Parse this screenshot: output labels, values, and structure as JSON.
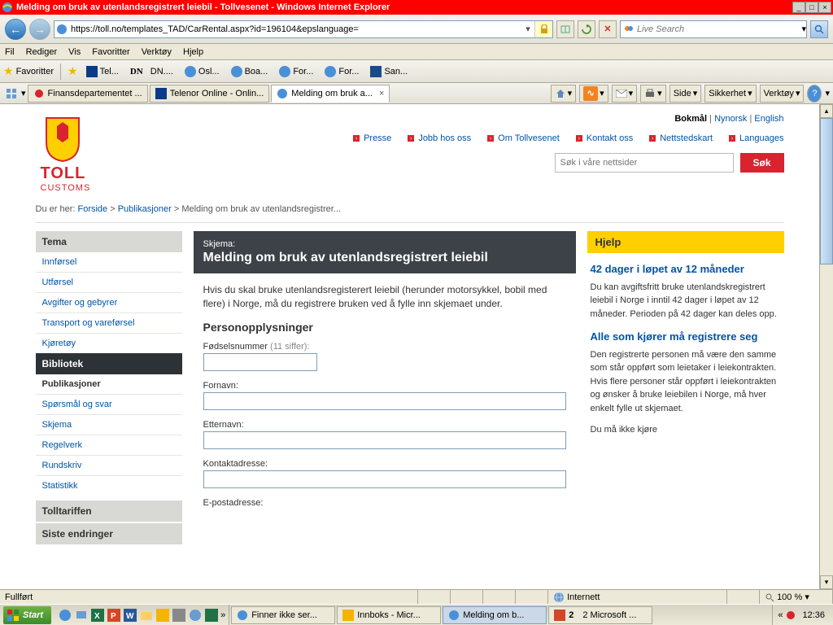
{
  "window": {
    "title": "Melding om bruk av utenlandsregistrert leiebil - Tollvesenet - Windows Internet Explorer",
    "address_url": "https://toll.no/templates_TAD/CarRental.aspx?id=196104&epslanguage=",
    "search_placeholder": "Live Search"
  },
  "menu": {
    "file": "Fil",
    "edit": "Rediger",
    "view": "Vis",
    "favorites": "Favoritter",
    "tools": "Verktøy",
    "help": "Hjelp"
  },
  "bookmarks_label": "Favoritter",
  "bookmarks": [
    {
      "label": "Tel..."
    },
    {
      "label": "DN...."
    },
    {
      "label": "Osl..."
    },
    {
      "label": "Boa..."
    },
    {
      "label": "For..."
    },
    {
      "label": "For..."
    },
    {
      "label": "San..."
    }
  ],
  "tabs": [
    {
      "label": "Finansdepartementet ..."
    },
    {
      "label": "Telenor Online - Onlin..."
    },
    {
      "label": "Melding om bruk a...",
      "active": true
    }
  ],
  "cmdbar": {
    "side": "Side",
    "sikkerhet": "Sikkerhet",
    "verktoy": "Verktøy"
  },
  "page": {
    "lang": {
      "bokmal": "Bokmål",
      "nynorsk": "Nynorsk",
      "english": "English"
    },
    "logo": {
      "line1": "TOLL",
      "line2": "CUSTOMS"
    },
    "topnav": [
      {
        "label": "Presse"
      },
      {
        "label": "Jobb hos oss"
      },
      {
        "label": "Om Tollvesenet"
      },
      {
        "label": "Kontakt oss"
      },
      {
        "label": "Nettstedskart"
      },
      {
        "label": "Languages"
      }
    ],
    "search_placeholder": "Søk i våre nettsider",
    "search_button": "Søk",
    "breadcrumb": {
      "prefix": "Du er her:",
      "p1": "Forside",
      "p2": "Publikasjoner",
      "p3": "Melding om bruk av utenlandsregistrer..."
    },
    "left": {
      "tema_title": "Tema",
      "tema_items": [
        "Innførsel",
        "Utførsel",
        "Avgifter og gebyrer",
        "Transport og vareførsel",
        "Kjøretøy"
      ],
      "bibliotek_title": "Bibliotek",
      "bibliotek_items": [
        "Publikasjoner",
        "Spørsmål og svar",
        "Skjema",
        "Regelverk",
        "Rundskriv",
        "Statistikk"
      ],
      "tolltariffen": "Tolltariffen",
      "siste": "Siste endringer"
    },
    "form": {
      "skjema": "Skjema:",
      "title": "Melding om bruk av utenlandsregistrert leiebil",
      "intro": "Hvis du skal bruke utenlandsregisterert leiebil (herunder motorsykkel, bobil med flere) i Norge, må du registrere bruken ved å fylle inn skjemaet under.",
      "section": "Personopplysninger",
      "f_fodsel": "Fødselsnummer",
      "f_fodsel_hint": "(11 siffer):",
      "f_fornavn": "Fornavn:",
      "f_etternavn": "Etternavn:",
      "f_kontakt": "Kontaktadresse:",
      "f_epost": "E-postadresse:"
    },
    "help": {
      "title": "Hjelp",
      "h1": "42 dager i løpet av 12 måneder",
      "p1": "Du kan avgiftsfritt bruke utenlandskregistrert leiebil i Norge i inntil 42 dager i løpet av 12 måneder. Perioden på 42 dager kan deles opp.",
      "h2": "Alle som kjører må registrere seg",
      "p2": "Den registrerte personen må være den samme som står oppført som leietaker i leiekontrakten. Hvis flere personer står oppført i leiekontrakten og ønsker å bruke leiebilen i Norge, må hver enkelt fylle ut skjemaet.",
      "p3": "Du må ikke kjøre"
    }
  },
  "status": {
    "left": "Fullført",
    "zone": "Internett",
    "zoom": "100 %"
  },
  "taskbar": {
    "start": "Start",
    "tasks": [
      {
        "label": "Finner ikke ser..."
      },
      {
        "label": "Innboks - Micr..."
      },
      {
        "label": "Melding om b...",
        "active": true
      },
      {
        "label": "2 Microsoft ..."
      }
    ],
    "clock": "12:36"
  }
}
